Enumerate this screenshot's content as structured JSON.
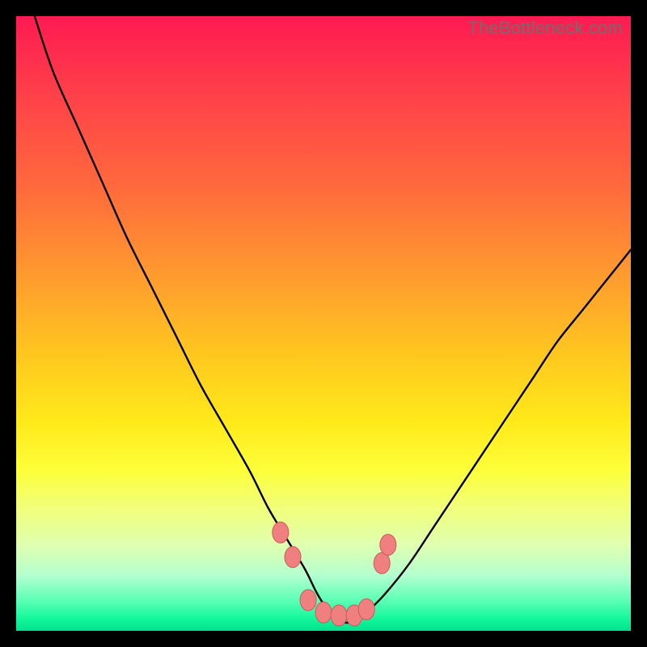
{
  "watermark": "TheBottleneck.com",
  "colors": {
    "frame": "#000000",
    "curve": "#000000",
    "markerFill": "#f08080",
    "markerStroke": "#cc5a5a"
  },
  "chart_data": {
    "type": "line",
    "title": "",
    "xlabel": "",
    "ylabel": "",
    "xlim": [
      0,
      100
    ],
    "ylim": [
      0,
      100
    ],
    "annotations": [],
    "series": [
      {
        "name": "bottleneck-curve",
        "x": [
          3,
          6,
          10,
          14,
          18,
          22,
          26,
          30,
          34,
          38,
          41,
          44,
          47,
          49,
          51,
          53,
          55,
          57,
          60,
          64,
          68,
          72,
          76,
          80,
          84,
          88,
          92,
          96,
          100
        ],
        "y": [
          100,
          91,
          82,
          73,
          64,
          56,
          48,
          40,
          33,
          26,
          20,
          15,
          10,
          6,
          3,
          1.5,
          1.5,
          3,
          6,
          11,
          17,
          23,
          29,
          35,
          41,
          47,
          52,
          57,
          62
        ]
      }
    ],
    "markers": {
      "name": "highlight-points",
      "x": [
        43,
        45,
        47.5,
        50,
        52.5,
        55,
        57,
        59.5,
        60.5
      ],
      "y": [
        16,
        12,
        5,
        3,
        2.5,
        2.5,
        3.5,
        11,
        14
      ]
    }
  }
}
